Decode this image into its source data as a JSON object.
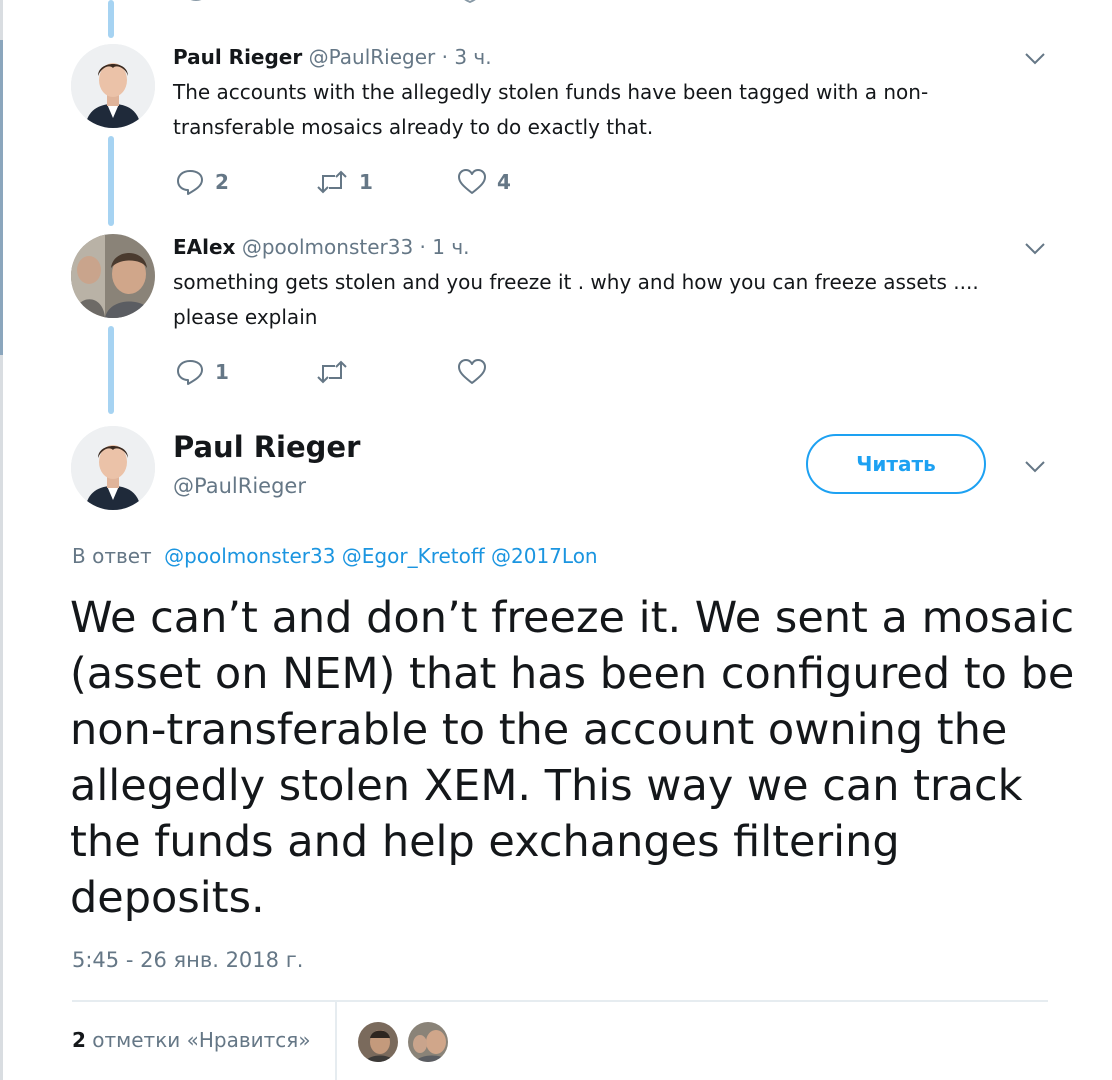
{
  "thread": [
    {
      "name": "Paul Rieger",
      "meta": "@PaulRieger · 3 ч.",
      "text": "The accounts with the allegedly stolen funds have been tagged with a non-transferable mosaics already to do exactly that.",
      "replies": "2",
      "retweets": "1",
      "likes": "4"
    },
    {
      "name": "EAlex",
      "meta": "@poolmonster33 · 1 ч.",
      "text": "something gets stolen and you freeze it . why and how you can freeze assets .... please explain",
      "replies": "1",
      "retweets": "",
      "likes": ""
    }
  ],
  "main_tweet": {
    "name": "Paul Rieger",
    "handle": "@PaulRieger",
    "follow_label": "Читать",
    "reply_prefix": "В ответ",
    "reply_to": "@poolmonster33 @Egor_Kretoff @2017Lon",
    "text": "We can’t and don’t freeze it. We sent a mosaic (asset on NEM) that has been configured to be non-transferable to the account owning the allegedly stolen XEM. This way we can track the funds and help exchanges filtering deposits.",
    "timestamp": "5:45 - 26 янв. 2018 г.",
    "likes_count": "2",
    "likes_label": "отметки «Нравится»"
  },
  "colors": {
    "accent": "#1da1f2",
    "link": "#1b95e0",
    "muted": "#657786",
    "thread_line": "#a6d3f2"
  },
  "icons": [
    "reply-icon",
    "retweet-icon",
    "like-icon",
    "chevron-down-icon"
  ]
}
